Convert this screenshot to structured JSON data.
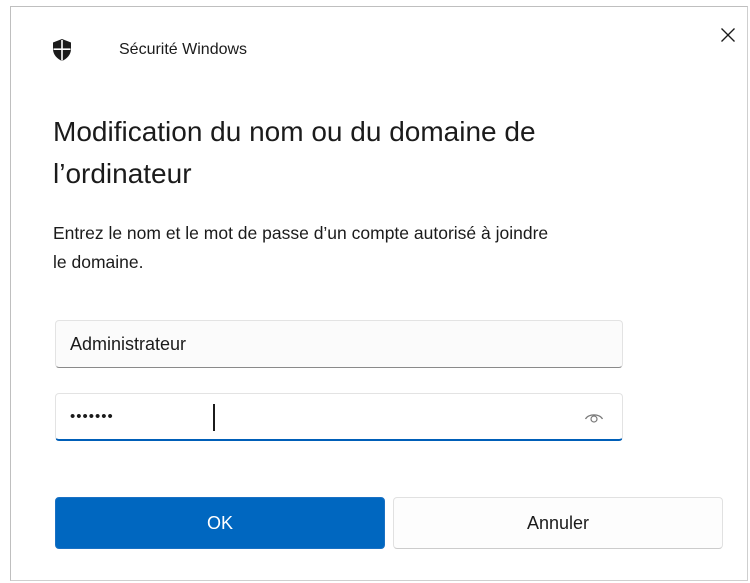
{
  "window": {
    "app_title": "Sécurité Windows",
    "app_icon": "shield-icon",
    "close_icon": "close-icon"
  },
  "dialog": {
    "heading_line1": "Modification du nom ou du domaine de",
    "heading_line2": "l’ordinateur",
    "description_line1": "Entrez le nom et le mot de passe d’un compte autorisé à joindre",
    "description_line2": "le domaine."
  },
  "form": {
    "username_value": "Administrateur",
    "password_masked": "•••••••",
    "reveal_icon": "eye-icon"
  },
  "buttons": {
    "ok_label": "OK",
    "cancel_label": "Annuler"
  },
  "colors": {
    "accent": "#0067c0",
    "focus_underline": "#005fb8"
  }
}
